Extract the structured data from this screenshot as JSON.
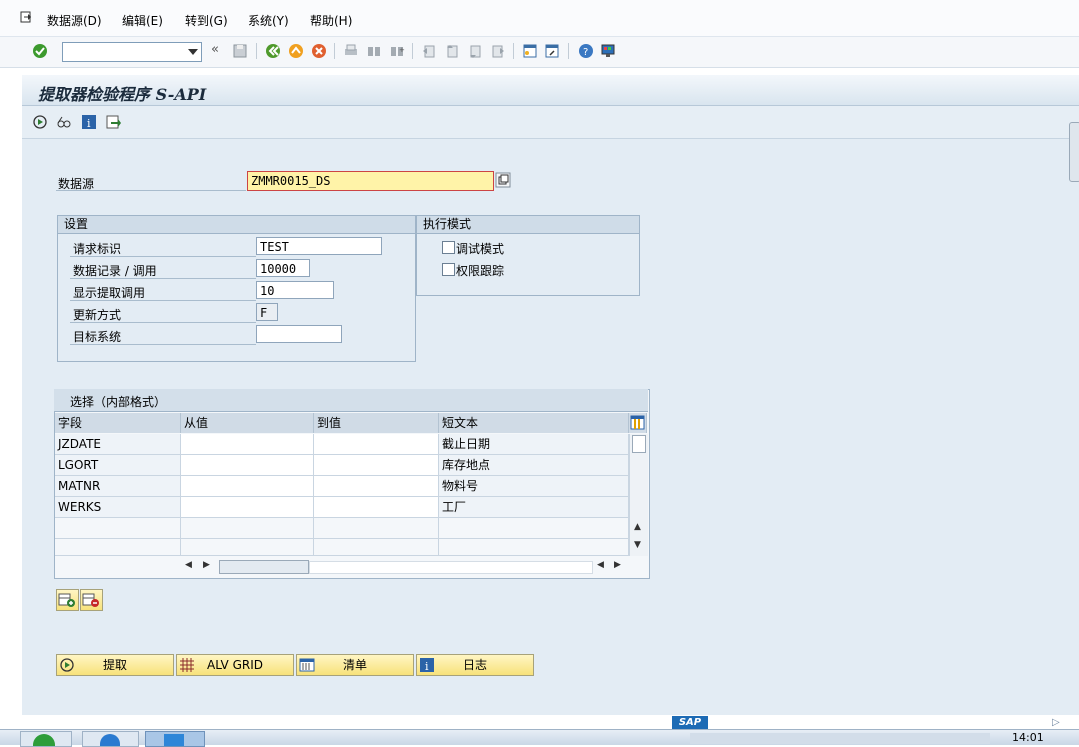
{
  "menu": {
    "items": [
      "数据源(D)",
      "编辑(E)",
      "转到(G)",
      "系统(Y)",
      "帮助(H)"
    ]
  },
  "toolbar": {
    "command_field_value": "",
    "icons": [
      "enter-icon",
      "back-icon",
      "save-icon",
      "navigate-back-icon",
      "exit-icon",
      "cancel-icon",
      "print-icon",
      "find-icon",
      "find-next-icon",
      "first-page-icon",
      "previous-page-icon",
      "next-page-icon",
      "last-page-icon",
      "create-session-icon",
      "shortcut-icon",
      "help-icon",
      "customize-icon"
    ]
  },
  "screen": {
    "title": "提取器检验程序 S-API"
  },
  "datasource": {
    "label": "数据源",
    "value": "ZMMR0015_DS"
  },
  "settings": {
    "title": "设置",
    "rows": [
      {
        "label": "请求标识",
        "value": "TEST"
      },
      {
        "label": "数据记录 / 调用",
        "value": "10000"
      },
      {
        "label": "显示提取调用",
        "value": "10"
      },
      {
        "label": "更新方式",
        "value": "F"
      },
      {
        "label": "目标系统",
        "value": ""
      }
    ]
  },
  "exec_mode": {
    "title": "执行模式",
    "options": [
      {
        "label": "调试模式",
        "checked": false
      },
      {
        "label": "权限跟踪",
        "checked": false
      }
    ]
  },
  "selection": {
    "title": "选择（内部格式）",
    "columns": [
      "字段",
      "从值",
      "到值",
      "短文本"
    ],
    "rows": [
      {
        "field": "JZDATE",
        "from": "",
        "to": "",
        "text": "截止日期"
      },
      {
        "field": "LGORT",
        "from": "",
        "to": "",
        "text": "库存地点"
      },
      {
        "field": "MATNR",
        "from": "",
        "to": "",
        "text": "物料号"
      },
      {
        "field": "WERKS",
        "from": "",
        "to": "",
        "text": "工厂"
      }
    ]
  },
  "buttons": {
    "extract": "提取",
    "alv_grid": "ALV GRID",
    "list": "清单",
    "log": "日志"
  },
  "taskbar": {
    "clock": "14:01"
  },
  "colors": {
    "button_bg": "#f7e27a",
    "focus_field": "#fff3a8"
  }
}
